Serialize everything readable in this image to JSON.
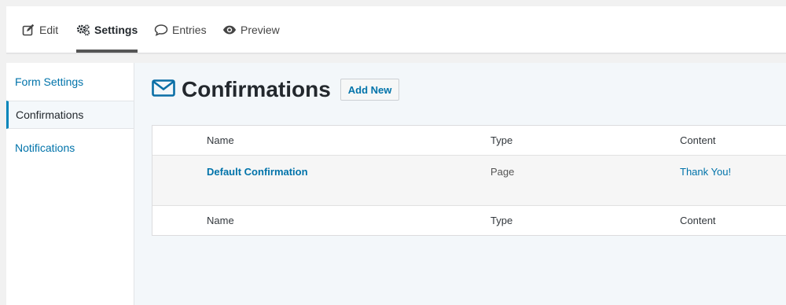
{
  "tabs": [
    {
      "label": "Edit",
      "icon": "edit-icon"
    },
    {
      "label": "Settings",
      "icon": "gears-icon",
      "active": true
    },
    {
      "label": "Entries",
      "icon": "comment-icon"
    },
    {
      "label": "Preview",
      "icon": "eye-icon"
    }
  ],
  "sidebar": {
    "items": [
      {
        "label": "Form Settings"
      },
      {
        "label": "Confirmations",
        "active": true
      },
      {
        "label": "Notifications"
      }
    ]
  },
  "main": {
    "title": "Confirmations",
    "title_icon": "envelope-icon",
    "add_new_label": "Add New"
  },
  "table": {
    "columns": [
      "Name",
      "Type",
      "Content"
    ],
    "rows": [
      {
        "name": "Default Confirmation",
        "type": "Page",
        "content": "Thank You!"
      }
    ]
  },
  "colors": {
    "link": "#0073aa",
    "active_border": "#0085ba",
    "icon_blue": "#0a6fa6"
  }
}
